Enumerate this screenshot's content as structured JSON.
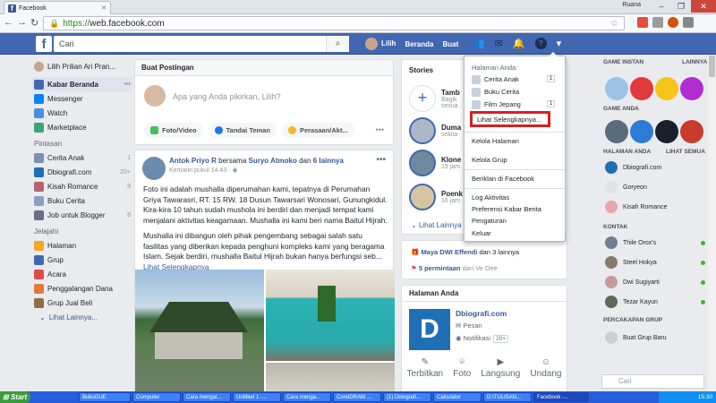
{
  "browser": {
    "tab_title": "Facebook",
    "profile_name": "Ruana",
    "url_scheme": "https://",
    "url_host": "web.facebook.com",
    "window_controls": [
      "–",
      "❐",
      "✕"
    ]
  },
  "header": {
    "logo": "f",
    "search_placeholder": "Cari",
    "nav": [
      "Lilih",
      "Beranda",
      "Buat"
    ]
  },
  "left_sidebar": {
    "profile": "Lilih Prilian Ari Pran...",
    "main_items": [
      {
        "label": "Kabar Beranda",
        "icon": "news-feed-icon",
        "color": "#4267b2"
      },
      {
        "label": "Messenger",
        "icon": "messenger-icon",
        "color": "#0084ff"
      },
      {
        "label": "Watch",
        "icon": "watch-icon",
        "color": "#4a90e2"
      },
      {
        "label": "Marketplace",
        "icon": "marketplace-icon",
        "color": "#3aa57a"
      }
    ],
    "shortcuts_header": "Pintasan",
    "shortcuts": [
      {
        "label": "Cerita Anak",
        "count": "1",
        "color": "#7b8fb4"
      },
      {
        "label": "Dbiografi.com",
        "count": "20+",
        "color": "#1f6fb5"
      },
      {
        "label": "Kisah Romance",
        "count": "9",
        "color": "#b5646f"
      },
      {
        "label": "Buku Cerita",
        "count": "",
        "color": "#8aa0c0"
      },
      {
        "label": "Job untuk Blogger",
        "count": "8",
        "color": "#6b6f80"
      }
    ],
    "explore_header": "Jelajahi",
    "explore": [
      {
        "label": "Halaman",
        "color": "#f5a623"
      },
      {
        "label": "Grup",
        "color": "#4267b2"
      },
      {
        "label": "Acara",
        "color": "#e24a4a"
      },
      {
        "label": "Penggalangan Dana",
        "color": "#e07b39"
      },
      {
        "label": "Grup Jual Beli",
        "color": "#8b6f47"
      }
    ],
    "more": "Lihat Lainnya..."
  },
  "composer": {
    "header": "Buat Postingan",
    "placeholder": "Apa yang Anda pikirkan, Lilih?",
    "actions": [
      "Foto/Video",
      "Tandai Teman",
      "Perasaan/Akt..."
    ]
  },
  "post": {
    "author": "Antok Priyo R",
    "with_text": "bersama",
    "tagged": "Suryo Atmoko",
    "and_text": "dan",
    "others": "6 lainnya",
    "time": "Kemarin pukul 14.43",
    "paragraph1": "Foto ini adalah mushalla diperumahan kami, tepatnya di Perumahan Griya Tawarasri, RT. 15 RW. 18 Dusun Tawarsari Wonosari, Gunungkidul. Kira-kira 10 tahun sudah mushola ini berdiri dan menjadi tempat kami menjalani aktivitas keagamaan. Mushalla ini kami beri nama Baitul Hijrah.",
    "paragraph2": "Mushalla ini dibangun oleh pihak pengembang sebagai salah satu fasilitas yang diberikan kepada penghuni kompleks kami yang beragama Islam. Sejak berdiri, mushalla Baitul Hijrah bukan hanya berfungsi seb...",
    "read_more": "Lihat Selengkapnya"
  },
  "stories": {
    "header": "Stories",
    "items": [
      {
        "name": "Tamb",
        "sub1": "Bagik",
        "sub2": "sesua"
      },
      {
        "name": "Duma",
        "sub1": "sekita",
        "sub2": ""
      },
      {
        "name": "Klone",
        "sub1": "19 jam",
        "sub2": ""
      },
      {
        "name": "Poenk",
        "sub1": "16 jam",
        "sub2": ""
      }
    ],
    "more": "Lihat Lainnya"
  },
  "notifications": {
    "row1_name": "Maya DWI Effendi",
    "row1_rest": "dan 3 lainnya",
    "row2_name": "5 permintaan",
    "row2_rest": "dari Ve Dee"
  },
  "your_pages": {
    "header": "Halaman Anda",
    "logo_letter": "D",
    "name": "Dbiografi.com",
    "messages": "Pesan",
    "notifs": "Notifikasi",
    "notif_count": "20+",
    "actions": [
      "Terbitkan",
      "Foto",
      "Langsung",
      "Undang"
    ]
  },
  "dropdown": {
    "section": "Halaman Anda:",
    "pages": [
      {
        "label": "Cerita Anak",
        "count": "1"
      },
      {
        "label": "Buku Cerita",
        "count": ""
      },
      {
        "label": "Film Jepang",
        "count": "1"
      }
    ],
    "see_more": "Lihat Selengkapnya...",
    "items": [
      "Kelola Halaman",
      "Kelola Grup",
      "Beriklan di Facebook",
      "Log Aktivitas",
      "Preferensi Kabar Berita",
      "Pengaturan",
      "Keluar"
    ]
  },
  "right_sidebar": {
    "instant_games": "GAME INSTAN",
    "more": "LAINNYA",
    "your_games": "GAME ANDA",
    "your_pages": "HALAMAN ANDA",
    "see_all": "LIHAT SEMUA",
    "pages": [
      "Dbiografi.com",
      "Goryeon",
      "Kisah Romance"
    ],
    "contacts": "KONTAK",
    "contacts_list": [
      "Thile Orox's",
      "Steel Hokya",
      "Dwi Sugiyarti",
      "Tezar Kayun"
    ],
    "group_chats": "PERCAKAPAN GRUP",
    "new_group": "Buat Grup Baru",
    "chat_search": "Cari"
  },
  "taskbar": {
    "start": "Start",
    "items": [
      "BukuGUE",
      "Computer",
      "Cara mengat...",
      "Untitled 1 -...",
      "Cara menga...",
      "CorelDRAW ...",
      "(1) Dbiografi...",
      "Calculator",
      "D:\\TULISAN...",
      "Facebook -..."
    ],
    "clock": "15:30"
  },
  "colors": {
    "fb_blue": "#4267b2",
    "link": "#385898",
    "highlight": "#d62020"
  }
}
